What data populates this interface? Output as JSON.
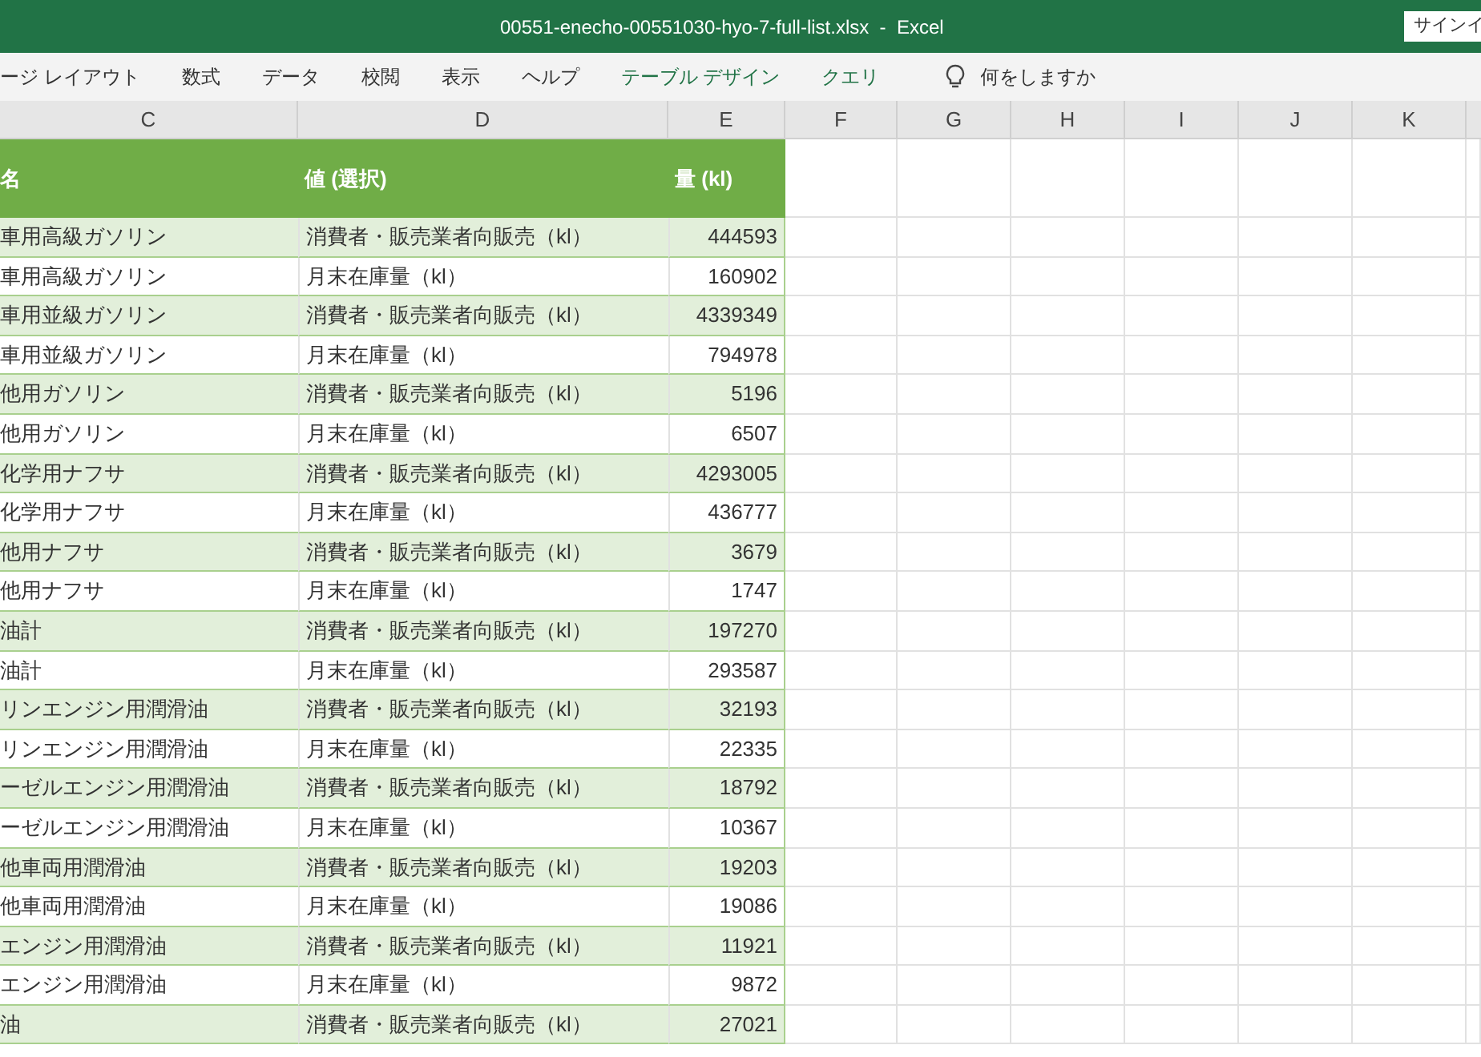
{
  "window": {
    "title": "00551-enecho-00551030-hyo-7-full-list.xlsx  -  Excel",
    "signin_button": "サインイ"
  },
  "ribbon_tabs": [
    {
      "label": "ージ レイアウト",
      "kind": "normal"
    },
    {
      "label": "数式",
      "kind": "normal"
    },
    {
      "label": "データ",
      "kind": "normal"
    },
    {
      "label": "校閲",
      "kind": "normal"
    },
    {
      "label": "表示",
      "kind": "normal"
    },
    {
      "label": "ヘルプ",
      "kind": "normal"
    },
    {
      "label": "テーブル デザイン",
      "kind": "contextual"
    },
    {
      "label": "クエリ",
      "kind": "contextual"
    }
  ],
  "tell_me": {
    "placeholder": "何をしますか"
  },
  "column_headers": [
    "C",
    "D",
    "E",
    "F",
    "G",
    "H",
    "I",
    "J",
    "K"
  ],
  "table": {
    "columns": [
      "名",
      "値 (選択)",
      "量 (kl)"
    ],
    "rows": [
      [
        "車用高級ガソリン",
        "消費者・販売業者向販売（kl）",
        "444593"
      ],
      [
        "車用高級ガソリン",
        "月末在庫量（kl）",
        "160902"
      ],
      [
        "車用並級ガソリン",
        "消費者・販売業者向販売（kl）",
        "4339349"
      ],
      [
        "車用並級ガソリン",
        "月末在庫量（kl）",
        "794978"
      ],
      [
        "他用ガソリン",
        "消費者・販売業者向販売（kl）",
        "5196"
      ],
      [
        "他用ガソリン",
        "月末在庫量（kl）",
        "6507"
      ],
      [
        "化学用ナフサ",
        "消費者・販売業者向販売（kl）",
        "4293005"
      ],
      [
        "化学用ナフサ",
        "月末在庫量（kl）",
        "436777"
      ],
      [
        "他用ナフサ",
        "消費者・販売業者向販売（kl）",
        "3679"
      ],
      [
        "他用ナフサ",
        "月末在庫量（kl）",
        "1747"
      ],
      [
        "油計",
        "消費者・販売業者向販売（kl）",
        "197270"
      ],
      [
        "油計",
        "月末在庫量（kl）",
        "293587"
      ],
      [
        "リンエンジン用潤滑油",
        "消費者・販売業者向販売（kl）",
        "32193"
      ],
      [
        "リンエンジン用潤滑油",
        "月末在庫量（kl）",
        "22335"
      ],
      [
        "ーゼルエンジン用潤滑油",
        "消費者・販売業者向販売（kl）",
        "18792"
      ],
      [
        "ーゼルエンジン用潤滑油",
        "月末在庫量（kl）",
        "10367"
      ],
      [
        "他車両用潤滑油",
        "消費者・販売業者向販売（kl）",
        "19203"
      ],
      [
        "他車両用潤滑油",
        "月末在庫量（kl）",
        "19086"
      ],
      [
        "エンジン用潤滑油",
        "消費者・販売業者向販売（kl）",
        "11921"
      ],
      [
        "エンジン用潤滑油",
        "月末在庫量（kl）",
        "9872"
      ],
      [
        "油",
        "消費者・販売業者向販売（kl）",
        "27021"
      ]
    ]
  }
}
